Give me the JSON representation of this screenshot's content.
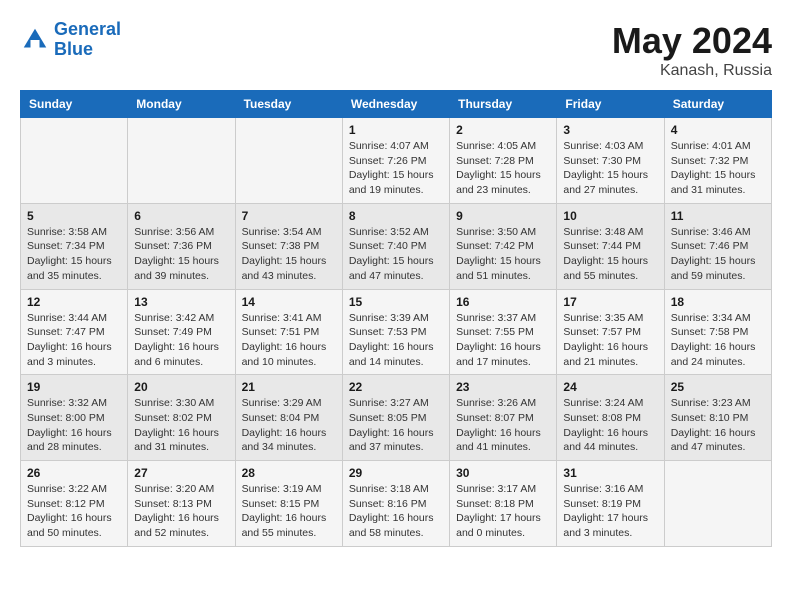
{
  "header": {
    "logo_line1": "General",
    "logo_line2": "Blue",
    "title": "May 2024",
    "subtitle": "Kanash, Russia"
  },
  "weekdays": [
    "Sunday",
    "Monday",
    "Tuesday",
    "Wednesday",
    "Thursday",
    "Friday",
    "Saturday"
  ],
  "weeks": [
    [
      {
        "day": "",
        "detail": ""
      },
      {
        "day": "",
        "detail": ""
      },
      {
        "day": "",
        "detail": ""
      },
      {
        "day": "1",
        "detail": "Sunrise: 4:07 AM\nSunset: 7:26 PM\nDaylight: 15 hours\nand 19 minutes."
      },
      {
        "day": "2",
        "detail": "Sunrise: 4:05 AM\nSunset: 7:28 PM\nDaylight: 15 hours\nand 23 minutes."
      },
      {
        "day": "3",
        "detail": "Sunrise: 4:03 AM\nSunset: 7:30 PM\nDaylight: 15 hours\nand 27 minutes."
      },
      {
        "day": "4",
        "detail": "Sunrise: 4:01 AM\nSunset: 7:32 PM\nDaylight: 15 hours\nand 31 minutes."
      }
    ],
    [
      {
        "day": "5",
        "detail": "Sunrise: 3:58 AM\nSunset: 7:34 PM\nDaylight: 15 hours\nand 35 minutes."
      },
      {
        "day": "6",
        "detail": "Sunrise: 3:56 AM\nSunset: 7:36 PM\nDaylight: 15 hours\nand 39 minutes."
      },
      {
        "day": "7",
        "detail": "Sunrise: 3:54 AM\nSunset: 7:38 PM\nDaylight: 15 hours\nand 43 minutes."
      },
      {
        "day": "8",
        "detail": "Sunrise: 3:52 AM\nSunset: 7:40 PM\nDaylight: 15 hours\nand 47 minutes."
      },
      {
        "day": "9",
        "detail": "Sunrise: 3:50 AM\nSunset: 7:42 PM\nDaylight: 15 hours\nand 51 minutes."
      },
      {
        "day": "10",
        "detail": "Sunrise: 3:48 AM\nSunset: 7:44 PM\nDaylight: 15 hours\nand 55 minutes."
      },
      {
        "day": "11",
        "detail": "Sunrise: 3:46 AM\nSunset: 7:46 PM\nDaylight: 15 hours\nand 59 minutes."
      }
    ],
    [
      {
        "day": "12",
        "detail": "Sunrise: 3:44 AM\nSunset: 7:47 PM\nDaylight: 16 hours\nand 3 minutes."
      },
      {
        "day": "13",
        "detail": "Sunrise: 3:42 AM\nSunset: 7:49 PM\nDaylight: 16 hours\nand 6 minutes."
      },
      {
        "day": "14",
        "detail": "Sunrise: 3:41 AM\nSunset: 7:51 PM\nDaylight: 16 hours\nand 10 minutes."
      },
      {
        "day": "15",
        "detail": "Sunrise: 3:39 AM\nSunset: 7:53 PM\nDaylight: 16 hours\nand 14 minutes."
      },
      {
        "day": "16",
        "detail": "Sunrise: 3:37 AM\nSunset: 7:55 PM\nDaylight: 16 hours\nand 17 minutes."
      },
      {
        "day": "17",
        "detail": "Sunrise: 3:35 AM\nSunset: 7:57 PM\nDaylight: 16 hours\nand 21 minutes."
      },
      {
        "day": "18",
        "detail": "Sunrise: 3:34 AM\nSunset: 7:58 PM\nDaylight: 16 hours\nand 24 minutes."
      }
    ],
    [
      {
        "day": "19",
        "detail": "Sunrise: 3:32 AM\nSunset: 8:00 PM\nDaylight: 16 hours\nand 28 minutes."
      },
      {
        "day": "20",
        "detail": "Sunrise: 3:30 AM\nSunset: 8:02 PM\nDaylight: 16 hours\nand 31 minutes."
      },
      {
        "day": "21",
        "detail": "Sunrise: 3:29 AM\nSunset: 8:04 PM\nDaylight: 16 hours\nand 34 minutes."
      },
      {
        "day": "22",
        "detail": "Sunrise: 3:27 AM\nSunset: 8:05 PM\nDaylight: 16 hours\nand 37 minutes."
      },
      {
        "day": "23",
        "detail": "Sunrise: 3:26 AM\nSunset: 8:07 PM\nDaylight: 16 hours\nand 41 minutes."
      },
      {
        "day": "24",
        "detail": "Sunrise: 3:24 AM\nSunset: 8:08 PM\nDaylight: 16 hours\nand 44 minutes."
      },
      {
        "day": "25",
        "detail": "Sunrise: 3:23 AM\nSunset: 8:10 PM\nDaylight: 16 hours\nand 47 minutes."
      }
    ],
    [
      {
        "day": "26",
        "detail": "Sunrise: 3:22 AM\nSunset: 8:12 PM\nDaylight: 16 hours\nand 50 minutes."
      },
      {
        "day": "27",
        "detail": "Sunrise: 3:20 AM\nSunset: 8:13 PM\nDaylight: 16 hours\nand 52 minutes."
      },
      {
        "day": "28",
        "detail": "Sunrise: 3:19 AM\nSunset: 8:15 PM\nDaylight: 16 hours\nand 55 minutes."
      },
      {
        "day": "29",
        "detail": "Sunrise: 3:18 AM\nSunset: 8:16 PM\nDaylight: 16 hours\nand 58 minutes."
      },
      {
        "day": "30",
        "detail": "Sunrise: 3:17 AM\nSunset: 8:18 PM\nDaylight: 17 hours\nand 0 minutes."
      },
      {
        "day": "31",
        "detail": "Sunrise: 3:16 AM\nSunset: 8:19 PM\nDaylight: 17 hours\nand 3 minutes."
      },
      {
        "day": "",
        "detail": ""
      }
    ]
  ]
}
